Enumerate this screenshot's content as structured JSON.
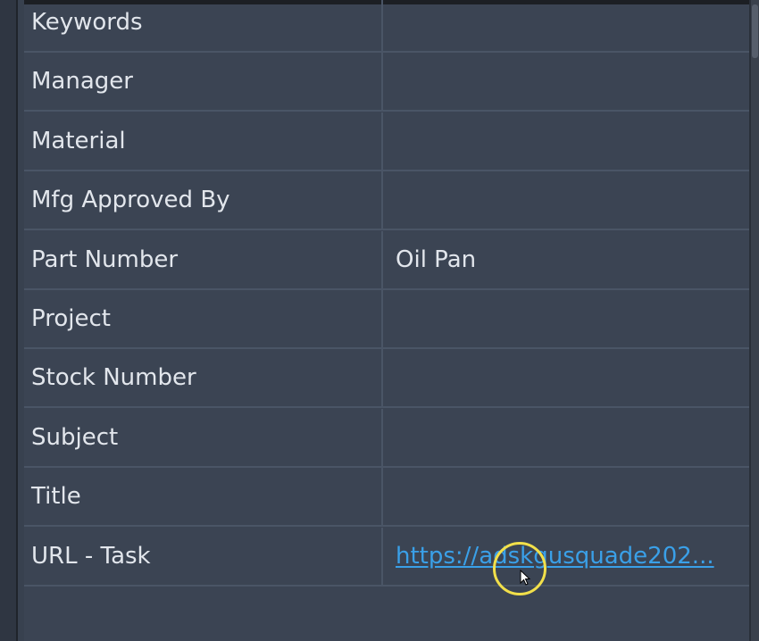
{
  "properties": {
    "rows": [
      {
        "label": "Keywords",
        "value": ""
      },
      {
        "label": "Manager",
        "value": ""
      },
      {
        "label": "Material",
        "value": ""
      },
      {
        "label": "Mfg Approved By",
        "value": ""
      },
      {
        "label": "Part Number",
        "value": "Oil Pan"
      },
      {
        "label": "Project",
        "value": ""
      },
      {
        "label": "Stock Number",
        "value": ""
      },
      {
        "label": "Subject",
        "value": ""
      },
      {
        "label": "Title",
        "value": ""
      },
      {
        "label": "URL - Task",
        "value": "https://adskgusquade202..."
      }
    ]
  },
  "colors": {
    "background": "#3b4453",
    "grid_line": "#4a5566",
    "text": "#e2e6ec",
    "link": "#3aa0e8",
    "cursor_highlight": "#f2e04a"
  },
  "icons": {
    "cursor": "mouse-pointer-icon"
  }
}
